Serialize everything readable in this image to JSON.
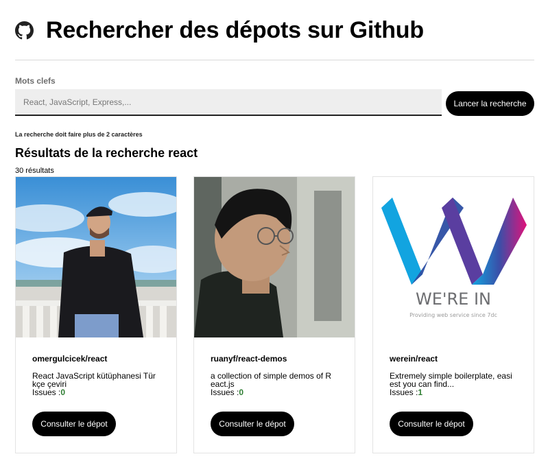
{
  "header": {
    "title": "Rechercher des dépots sur Github",
    "icon": "github-icon"
  },
  "search": {
    "label": "Mots clefs",
    "placeholder": "React, JavaScript, Express,...",
    "value": "",
    "button_label": "Lancer la recherche",
    "hint": "La recherche doit faire plus de 2 caractères"
  },
  "results": {
    "title": "Résultats de la recherche react",
    "count": "30 résultats",
    "issues_label": "Issues :",
    "consult_label": "Consulter le dépot",
    "items": [
      {
        "name": "omergulcicek/react",
        "description": "React JavaScript kütüphanesi Türkçe çeviri",
        "issues": "0",
        "avatar": "person-photo"
      },
      {
        "name": "ruanyf/react-demos",
        "description": "a collection of simple demos of React.js",
        "issues": "0",
        "avatar": "person-photo"
      },
      {
        "name": "werein/react",
        "description": "Extremely simple boilerplate, easiest you can find...",
        "issues": "1",
        "avatar": "werein-logo",
        "logo_text": "WE'RE IN",
        "logo_tagline": "Providing web service since 7dc"
      }
    ]
  }
}
